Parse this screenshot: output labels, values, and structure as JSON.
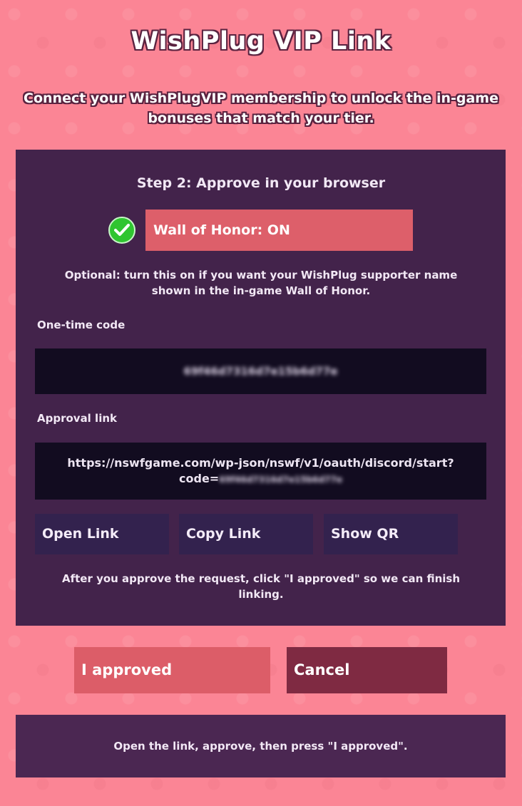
{
  "header": {
    "title": "WishPlug VIP Link",
    "subtitle_line1": "Connect your WishPlugVIP membership to unlock the in-game",
    "subtitle_line2": "bonuses that match your tier."
  },
  "panel": {
    "step_title": "Step 2: Approve in your browser",
    "wall_of_honor": {
      "label": "Wall of Honor: ON",
      "checked": true,
      "icon": "check-icon"
    },
    "optional_note_line1": "Optional: turn this on if you want your WishPlug supporter name",
    "optional_note_line2": "shown in the in-game Wall of Honor.",
    "one_time_code": {
      "label": "One-time code",
      "value": "69f46d7316d7e15b6d77e"
    },
    "approval_link": {
      "label": "Approval link",
      "url_line1": "https://nswfgame.com/wp-json/nswf/v1/oauth/discord/start?",
      "url_prefix": "code=",
      "code_blurred": "69f46d7316d7e15b6d77e"
    },
    "buttons": {
      "open_link": "Open Link",
      "copy_link": "Copy Link",
      "show_qr": "Show QR"
    },
    "after_note_line1": "After you approve the request, click \"I approved\" so we can finish",
    "after_note_line2": "linking."
  },
  "actions": {
    "approved": "I approved",
    "cancel": "Cancel"
  },
  "status": {
    "message": "Open the link, approve, then press \"I approved\"."
  },
  "colors": {
    "background": "#fb8595",
    "panel": "#43234b",
    "accent": "#dc5d68",
    "cancel": "#7f2a42",
    "field": "#120c20",
    "check": "#2fc530"
  }
}
